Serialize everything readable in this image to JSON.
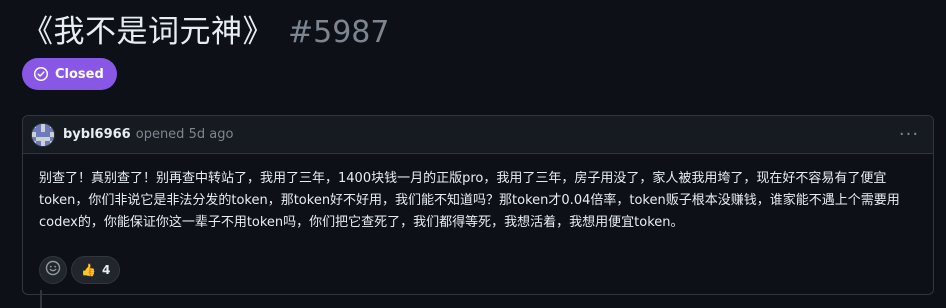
{
  "issue": {
    "title": "《我不是词元神》",
    "number": "#5987",
    "state": "Closed"
  },
  "comment": {
    "author": "bybl6966",
    "action": "opened",
    "time": "5d ago",
    "more_label": "···",
    "body": "别查了！真别查了！别再查中转站了，我用了三年，1400块钱一月的正版pro，我用了三年，房子用没了，家人被我用垮了，现在好不容易有了便宜token，你们非说它是非法分发的token，那token好不好用，我们能不知道吗？那token才0.04倍率，token贩子根本没赚钱，谁家能不遇上个需要用codex的，你能保证你这一辈子不用token吗，你们把它查死了，我们都得等死，我想活着，我想用便宜token。"
  },
  "reactions": {
    "add_reaction_icon": "smiley-icon",
    "items": [
      {
        "emoji": "👍",
        "count": "4"
      }
    ]
  },
  "colors": {
    "background": "#0d1117",
    "closed_purple": "#8957e5",
    "border": "#30363d",
    "muted": "#7d8590"
  }
}
